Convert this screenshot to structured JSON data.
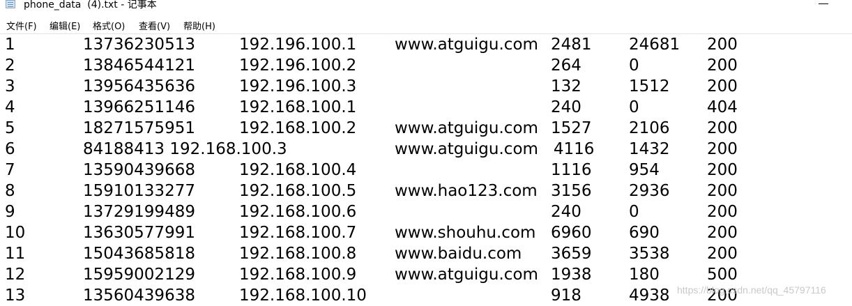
{
  "window": {
    "title": "phone_data  (4).txt - 记事本",
    "icon": "notepad-file-icon"
  },
  "menu": [
    "文件(F)",
    "编辑(E)",
    "格式(O)",
    "查看(V)",
    "帮助(H)"
  ],
  "lines": [
    [
      "1",
      "13736230513",
      "192.196.100.1",
      "www.atguigu.com",
      "2481",
      "24681",
      "200"
    ],
    [
      "2",
      "13846544121",
      "192.196.100.2",
      "",
      "264",
      "0",
      "200"
    ],
    [
      "3",
      "13956435636",
      "192.196.100.3",
      "",
      "132",
      "1512",
      "200"
    ],
    [
      "4",
      "13966251146",
      "192.168.100.1",
      "",
      "240",
      "0",
      "404"
    ],
    [
      "5",
      "18271575951",
      "192.168.100.2",
      "www.atguigu.com",
      "1527",
      "2106",
      "200"
    ],
    [
      "6",
      "84188413 192.168.100.3",
      "",
      "www.atguigu.com   4116",
      "",
      "1432",
      "200"
    ],
    [
      "7",
      "13590439668",
      "192.168.100.4",
      "",
      "1116",
      "954",
      "200"
    ],
    [
      "8",
      "15910133277",
      "192.168.100.5",
      "www.hao123.com",
      "3156",
      "2936",
      "200"
    ],
    [
      "9",
      "13729199489",
      "192.168.100.6",
      "",
      "240",
      "0",
      "200"
    ],
    [
      "10",
      "13630577991",
      "192.168.100.7",
      "www.shouhu.com",
      "6960",
      "690",
      "200"
    ],
    [
      "11",
      "15043685818",
      "192.168.100.8",
      "www.baidu.com",
      "3659",
      "3538",
      "200"
    ],
    [
      "12",
      "15959002129",
      "192.168.100.9",
      "www.atguigu.com",
      "1938",
      "180",
      "500"
    ],
    [
      "13",
      "13560439638",
      "192.168.100.10",
      "",
      "918",
      "4938",
      "200"
    ]
  ],
  "watermark": "https://blog.csdn.net/qq_45797116"
}
